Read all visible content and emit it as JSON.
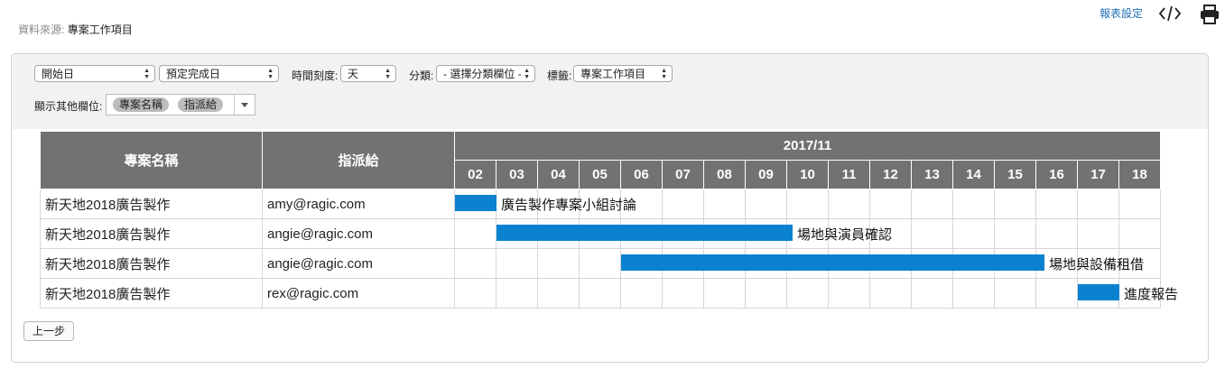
{
  "header": {
    "source_label": "資料來源:",
    "source_value": "專案工作項目",
    "report_settings": "報表設定"
  },
  "icons": {
    "code": "code-icon",
    "print": "print-icon"
  },
  "filters": {
    "start_field": "開始日",
    "end_field": "預定完成日",
    "time_scale_label": "時間刻度:",
    "time_scale_value": "天",
    "group_label": "分類:",
    "group_value": "- 選擇分類欄位 -",
    "tag_label": "標籤:",
    "tag_value": "專案工作項目",
    "other_fields_label": "顯示其他欄位:",
    "other_fields": [
      "專案名稱",
      "指派給"
    ]
  },
  "gantt": {
    "columns": [
      "專案名稱",
      "指派給"
    ],
    "month": "2017/11",
    "days": [
      "02",
      "03",
      "04",
      "05",
      "06",
      "07",
      "08",
      "09",
      "10",
      "11",
      "12",
      "13",
      "14",
      "15",
      "16",
      "17",
      "18"
    ],
    "bar_color": "#0a82cf",
    "rows": [
      {
        "project": "新天地2018廣告製作",
        "assignee": "amy@ragic.com",
        "task": "廣告製作專案小組討論",
        "start_day": "02",
        "end_day": "02"
      },
      {
        "project": "新天地2018廣告製作",
        "assignee": "angie@ragic.com",
        "task": "場地與演員確認",
        "start_day": "03",
        "end_day": "09"
      },
      {
        "project": "新天地2018廣告製作",
        "assignee": "angie@ragic.com",
        "task": "場地與設備租借",
        "start_day": "06",
        "end_day": "15"
      },
      {
        "project": "新天地2018廣告製作",
        "assignee": "rex@ragic.com",
        "task": "進度報告",
        "start_day": "17",
        "end_day": "17"
      }
    ]
  },
  "buttons": {
    "back": "上一步"
  }
}
